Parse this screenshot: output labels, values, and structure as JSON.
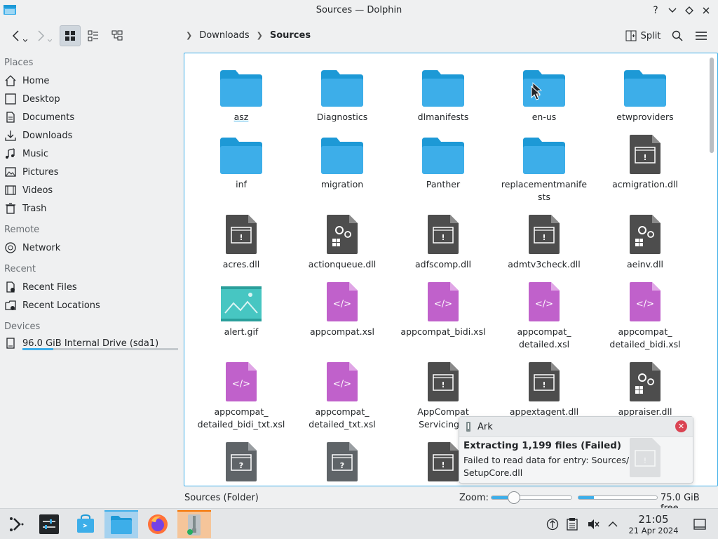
{
  "window": {
    "title": "Sources — Dolphin"
  },
  "toolbar": {
    "split_label": "Split"
  },
  "breadcrumb": {
    "parent": "Downloads",
    "current": "Sources"
  },
  "sidebar": {
    "places_label": "Places",
    "places": [
      {
        "label": "Home",
        "icon": "home-icon"
      },
      {
        "label": "Desktop",
        "icon": "desktop-icon"
      },
      {
        "label": "Documents",
        "icon": "documents-icon"
      },
      {
        "label": "Downloads",
        "icon": "downloads-icon"
      },
      {
        "label": "Music",
        "icon": "music-icon"
      },
      {
        "label": "Pictures",
        "icon": "pictures-icon"
      },
      {
        "label": "Videos",
        "icon": "videos-icon"
      },
      {
        "label": "Trash",
        "icon": "trash-icon"
      }
    ],
    "remote_label": "Remote",
    "remote": [
      {
        "label": "Network",
        "icon": "network-icon"
      }
    ],
    "recent_label": "Recent",
    "recent": [
      {
        "label": "Recent Files",
        "icon": "recent-files-icon"
      },
      {
        "label": "Recent Locations",
        "icon": "recent-locations-icon"
      }
    ],
    "devices_label": "Devices",
    "devices": [
      {
        "label": "96.0 GiB Internal Drive (sda1)",
        "icon": "drive-icon",
        "used_fraction": 0.2
      }
    ]
  },
  "files": [
    {
      "name": "asz",
      "type": "folder"
    },
    {
      "name": "Diagnostics",
      "type": "folder"
    },
    {
      "name": "dlmanifests",
      "type": "folder"
    },
    {
      "name": "en-us",
      "type": "folder"
    },
    {
      "name": "etwproviders",
      "type": "folder"
    },
    {
      "name": "inf",
      "type": "folder"
    },
    {
      "name": "migration",
      "type": "folder"
    },
    {
      "name": "Panther",
      "type": "folder"
    },
    {
      "name": "replacementmanifests",
      "type": "folder"
    },
    {
      "name": "acmigration.dll",
      "type": "dll"
    },
    {
      "name": "acres.dll",
      "type": "dll"
    },
    {
      "name": "actionqueue.dll",
      "type": "dll-gear"
    },
    {
      "name": "adfscomp.dll",
      "type": "dll"
    },
    {
      "name": "admtv3check.dll",
      "type": "dll"
    },
    {
      "name": "aeinv.dll",
      "type": "dll-gear"
    },
    {
      "name": "alert.gif",
      "type": "image"
    },
    {
      "name": "appcompat.xsl",
      "type": "xsl"
    },
    {
      "name": "appcompat_bidi.xsl",
      "type": "xsl"
    },
    {
      "name": "appcompat_detailed.xsl",
      "type": "xsl"
    },
    {
      "name": "appcompat_detailed_bidi.xsl",
      "type": "xsl"
    },
    {
      "name": "appcompat_detailed_bidi_txt.xsl",
      "type": "xsl"
    },
    {
      "name": "appcompat_detailed_txt.xsl",
      "type": "xsl"
    },
    {
      "name": "AppCompatServicing.dll",
      "type": "dll"
    },
    {
      "name": "appextagent.dll",
      "type": "dll"
    },
    {
      "name": "appraiser.dll",
      "type": "dll-gear"
    },
    {
      "name": "",
      "type": "unknown"
    },
    {
      "name": "",
      "type": "unknown"
    },
    {
      "name": "",
      "type": "dll"
    }
  ],
  "file_labels": {
    "f0": "asz",
    "f1": "Diagnostics",
    "f2": "dlmanifests",
    "f3": "en-us",
    "f4": "etwproviders",
    "f5": "inf",
    "f6": "migration",
    "f7": "Panther",
    "f8a": "replacementmanife",
    "f8b": "sts",
    "f9": "acmigration.dll",
    "f10": "acres.dll",
    "f11": "actionqueue.dll",
    "f12": "adfscomp.dll",
    "f13": "admtv3check.dll",
    "f14": "aeinv.dll",
    "f15": "alert.gif",
    "f16": "appcompat.xsl",
    "f17": "appcompat_bidi.xsl",
    "f18a": "appcompat_",
    "f18b": "detailed.xsl",
    "f19a": "appcompat_",
    "f19b": "detailed_bidi.xsl",
    "f20a": "appcompat_",
    "f20b": "detailed_bidi_txt.xsl",
    "f21a": "appcompat_",
    "f21b": "detailed_txt.xsl",
    "f22a": "AppCompat",
    "f22b": "Servicing.d",
    "f23": "appextagent.dll",
    "f24": "appraiser.dll"
  },
  "notification": {
    "app": "Ark",
    "title": "Extracting 1,199 files (Failed)",
    "body_line1": "Failed to read data for entry: Sources/",
    "body_line2": "SetupCore.dll"
  },
  "statusbar": {
    "left": "Sources (Folder)",
    "zoom_label": "Zoom:",
    "zoom_fraction": 0.28,
    "free_label": "75.0 GiB free",
    "used_fraction": 0.2
  },
  "taskbar": {
    "time": "21:05",
    "date": "21 Apr 2024"
  },
  "colors": {
    "accent": "#3daee9",
    "folder": "#3daee9",
    "folder_tab": "#1d99d6",
    "dll": "#4d4d4d",
    "xsl": "#c061cb",
    "close": "#da4453"
  }
}
